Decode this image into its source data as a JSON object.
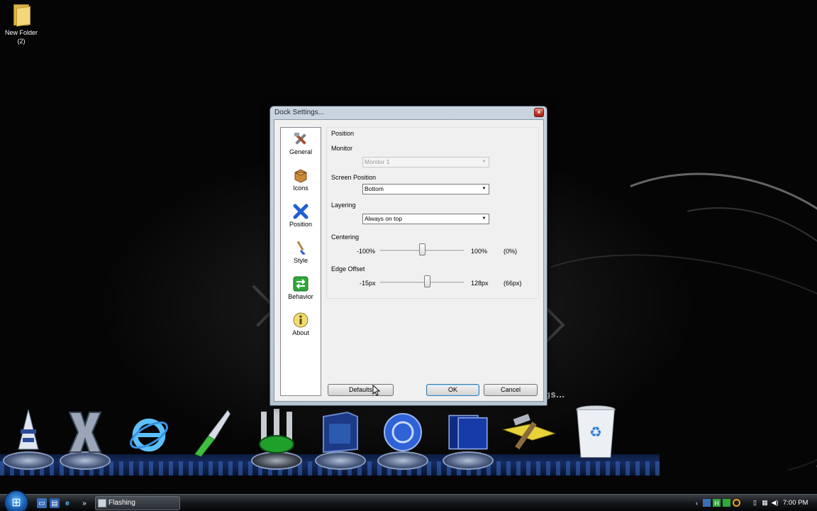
{
  "desktop": {
    "icon_label": "New Folder (2)",
    "wallpaper_text": "gs..."
  },
  "dialog": {
    "title": "Dock Settings...",
    "close_glyph": "×",
    "nav": [
      {
        "label": "General",
        "icon": "tools-icon"
      },
      {
        "label": "Icons",
        "icon": "box-icon"
      },
      {
        "label": "Position",
        "icon": "position-x-icon"
      },
      {
        "label": "Style",
        "icon": "brush-icon"
      },
      {
        "label": "Behavior",
        "icon": "behavior-arrows-icon"
      },
      {
        "label": "About",
        "icon": "info-icon"
      }
    ],
    "group_title": "Position",
    "monitor": {
      "label": "Monitor",
      "value": "Monitor 1",
      "enabled": false
    },
    "screen_position": {
      "label": "Screen Position",
      "value": "Bottom"
    },
    "layering": {
      "label": "Layering",
      "value": "Always on top"
    },
    "centering": {
      "label": "Centering",
      "min": "-100%",
      "max": "100%",
      "current": "(0%)",
      "value": 0,
      "range": [
        -100,
        100
      ]
    },
    "edge_offset": {
      "label": "Edge Offset",
      "min": "-15px",
      "max": "128px",
      "current": "(66px)",
      "value": 66,
      "range": [
        -15,
        128
      ]
    },
    "buttons": {
      "defaults": "Defaults",
      "ok": "OK",
      "cancel": "Cancel"
    }
  },
  "taskbar": {
    "start_glyph": "⊞",
    "task_button_label": "Flashing",
    "overflow_glyph": "»",
    "clock": "7:00 PM"
  },
  "colors": {
    "accent": "#3c7fb1",
    "close_red": "#c2382a"
  }
}
